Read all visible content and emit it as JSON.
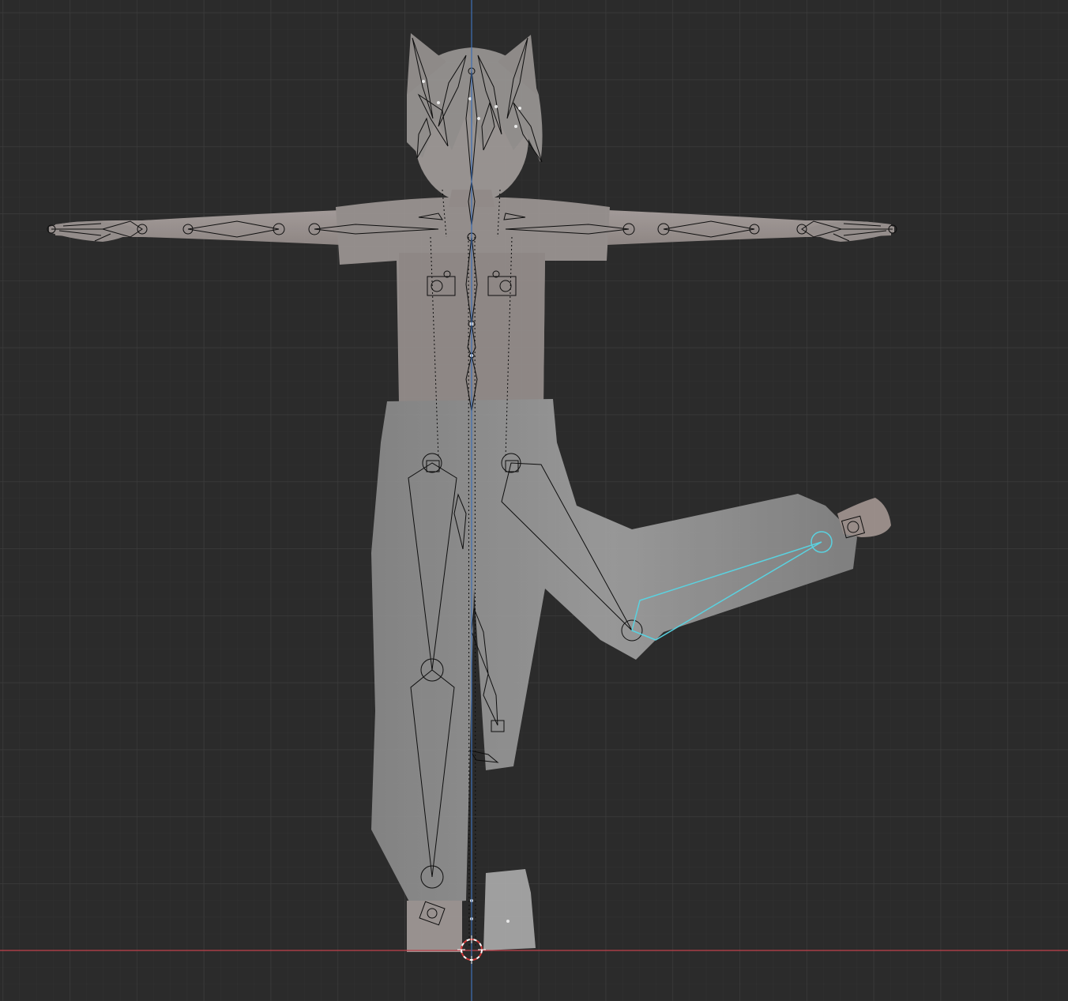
{
  "viewport": {
    "view": "front-orthographic",
    "mode": "pose",
    "background_color": "#2b2b2b",
    "grid_minor_color": "#323232",
    "grid_major_color": "#3c3c3c",
    "x_axis_color": "#c0404a",
    "z_axis_color": "#3d6fb5",
    "overlay_xray": true
  },
  "scene": {
    "mesh_icon": "character-mesh-icon",
    "armature_icon": "armature-bones-icon",
    "cursor_icon": "3d-cursor-icon",
    "mesh_color": "#a8a2a0",
    "bone_color": "#0e0e0e",
    "selected_bone_color": "#5ad2e0",
    "selected_bone_name": "",
    "visible_text": []
  }
}
